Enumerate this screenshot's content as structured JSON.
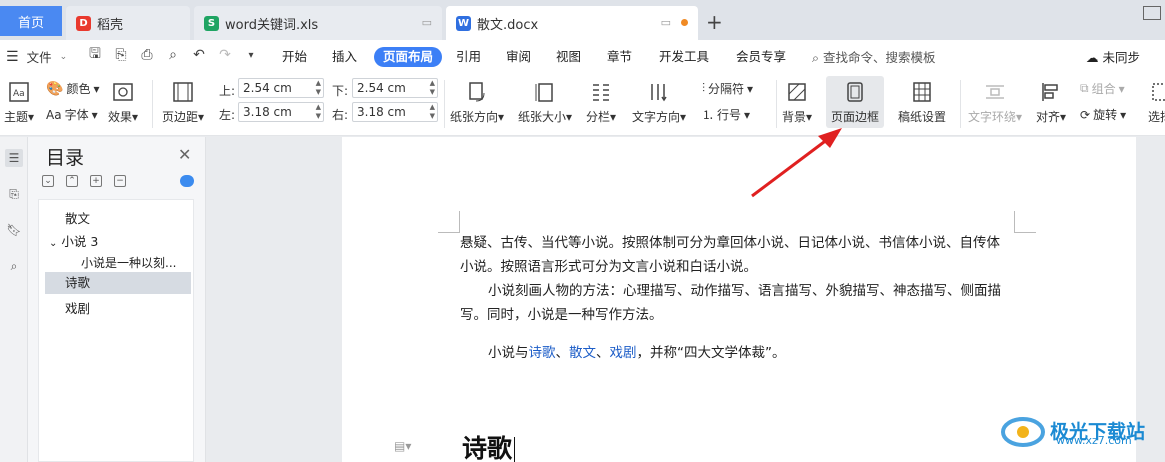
{
  "tabs": {
    "home": "首页",
    "t1": "稻壳",
    "t2": "word关键词.xls",
    "t3": "散文.docx",
    "new_tab": "+"
  },
  "menu": {
    "file": "文件",
    "items": [
      "开始",
      "插入",
      "页面布局",
      "引用",
      "审阅",
      "视图",
      "章节",
      "开发工具",
      "会员专享"
    ],
    "active": "页面布局",
    "search": "查找命令、搜索模板",
    "sync": "未同步"
  },
  "ribbon": {
    "theme": "主题",
    "color": "颜色",
    "font": "字体",
    "effect": "效果",
    "margins": "页边距",
    "top_label": "上:",
    "top_value": "2.54 cm",
    "bottom_label": "下:",
    "bottom_value": "2.54 cm",
    "left_label": "左:",
    "left_value": "3.18 cm",
    "right_label": "右:",
    "right_value": "3.18 cm",
    "orientation": "纸张方向",
    "size": "纸张大小",
    "columns": "分栏",
    "text_direction": "文字方向",
    "separator": "分隔符",
    "line_number": "行号",
    "background": "背景",
    "page_border": "页面边框",
    "paper_setup": "稿纸设置",
    "text_wrap": "文字环绕",
    "align": "对齐",
    "group": "组合",
    "rotate": "旋转",
    "select": "选择"
  },
  "toc": {
    "title": "目录",
    "items": [
      {
        "label": "散文"
      },
      {
        "label": "小说 3"
      },
      {
        "label": "小说是一种以刻..."
      },
      {
        "label": "诗歌"
      },
      {
        "label": "戏剧"
      }
    ],
    "selected": "诗歌"
  },
  "document": {
    "line1": "悬疑、古传、当代等小说。按照体制可分为章回体小说、日记体小说、书信体小说、自传体",
    "line2": "小说。按照语言形式可分为文言小说和白话小说。",
    "line3": "小说刻画人物的方法：心理描写、动作描写、语言描写、外貌描写、神态描写、侧面描",
    "line4": "写。同时，小说是一种写作方法。",
    "line5_pre": "小说与",
    "link1": "诗歌",
    "sep1": "、",
    "link2": "散文",
    "sep2": "、",
    "link3": "戏剧",
    "line5_post": "，并称“四大文学体裁”。",
    "heading": "诗歌"
  },
  "watermark": {
    "name": "极光下载站",
    "url": "www.xz7.com"
  },
  "colors": {
    "accent": "#3c7ff6",
    "arrow": "#e02020",
    "link": "#1e5ec8"
  }
}
